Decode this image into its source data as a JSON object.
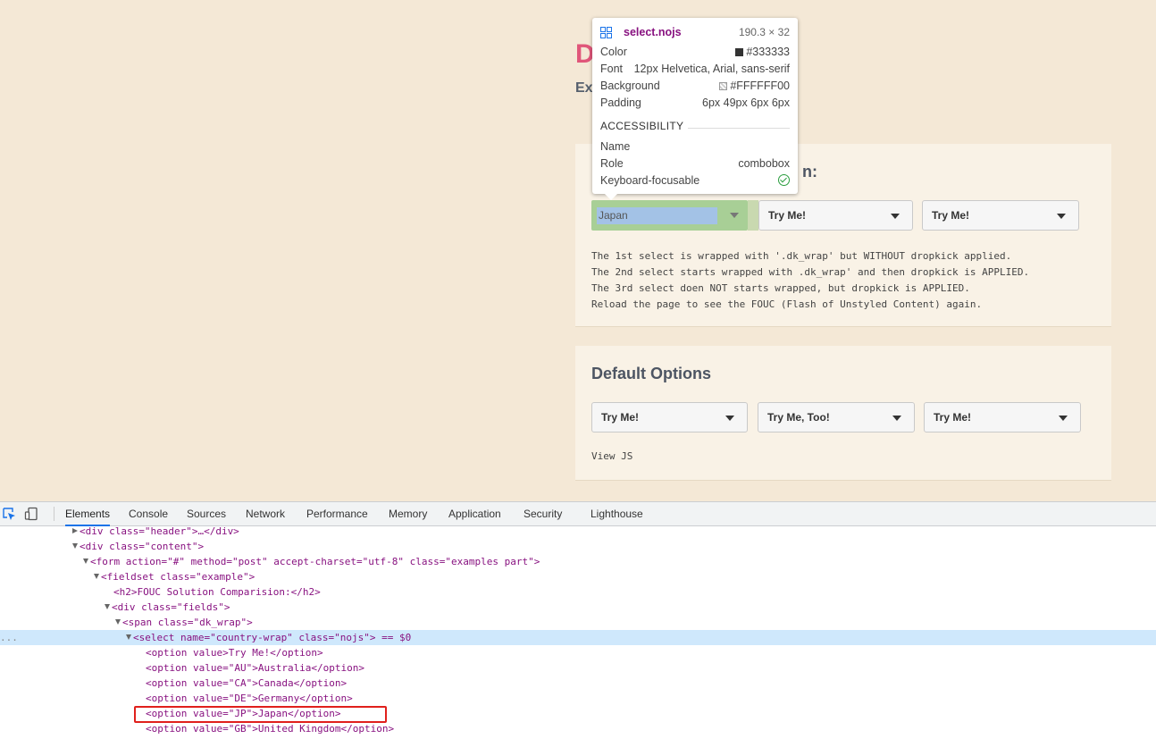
{
  "page": {
    "title": "D",
    "subtitle": "Ex",
    "fieldset1": {
      "title_fragment": "n:",
      "selects": [
        {
          "label": "Japan",
          "highlighted": true
        },
        {
          "label": "Try Me!"
        },
        {
          "label": "Try Me!"
        }
      ],
      "description": [
        "The 1st select is wrapped with '.dk_wrap' but WITHOUT dropkick applied.",
        "The 2nd select starts wrapped with .dk_wrap' and then dropkick is APPLIED.",
        "The 3rd select doen NOT starts wrapped, but dropkick is APPLIED.",
        "Reload the page to see the FOUC (Flash of Unstyled Content) again."
      ]
    },
    "fieldset2": {
      "title": "Default Options",
      "selects": [
        {
          "label": "Try Me!"
        },
        {
          "label": "Try Me, Too!"
        },
        {
          "label": "Try Me!"
        }
      ],
      "view_js": "View JS"
    }
  },
  "tooltip": {
    "selector": "select.nojs",
    "size": "190.3 × 32",
    "rows": [
      {
        "key": "Color",
        "value": "#333333",
        "swatch": "#333333"
      },
      {
        "key": "Font",
        "value": "12px Helvetica, Arial, sans-serif"
      },
      {
        "key": "Background",
        "value": "#FFFFFF00",
        "swatch": "#FFFFFF00"
      },
      {
        "key": "Padding",
        "value": "6px 49px 6px 6px"
      }
    ],
    "accessibility_heading": "ACCESSIBILITY",
    "a11y_rows": [
      {
        "key": "Name",
        "value": ""
      },
      {
        "key": "Role",
        "value": "combobox"
      },
      {
        "key": "Keyboard-focusable",
        "value": "check-icon"
      }
    ]
  },
  "devtools": {
    "tabs": [
      "Elements",
      "Console",
      "Sources",
      "Network",
      "Performance",
      "Memory",
      "Application",
      "Security",
      "Lighthouse"
    ],
    "active_tab": "Elements",
    "dom_lines": [
      {
        "text": "<div class=\"header\">…</div>"
      },
      {
        "text": "<div class=\"content\">"
      },
      {
        "text": "<form action=\"#\" method=\"post\" accept-charset=\"utf-8\" class=\"examples part\">"
      },
      {
        "text": "<fieldset class=\"example\">"
      },
      {
        "text": "<h2>FOUC Solution Comparision:</h2>"
      },
      {
        "text": "<div class=\"fields\">"
      },
      {
        "text": "<span class=\"dk_wrap\">"
      },
      {
        "text": "<select name=\"country-wrap\" class=\"nojs\"> == $0"
      },
      {
        "text": "<option value>Try Me!</option>"
      },
      {
        "text": "<option value=\"AU\">Australia</option>"
      },
      {
        "text": "<option value=\"CA\">Canada</option>"
      },
      {
        "text": "<option value=\"DE\">Germany</option>"
      },
      {
        "text": "<option value=\"JP\">Japan</option>"
      },
      {
        "text": "<option value=\"GB\">United Kingdom</option>"
      }
    ],
    "selected_marker": "...",
    "eq_text": "== $0"
  }
}
